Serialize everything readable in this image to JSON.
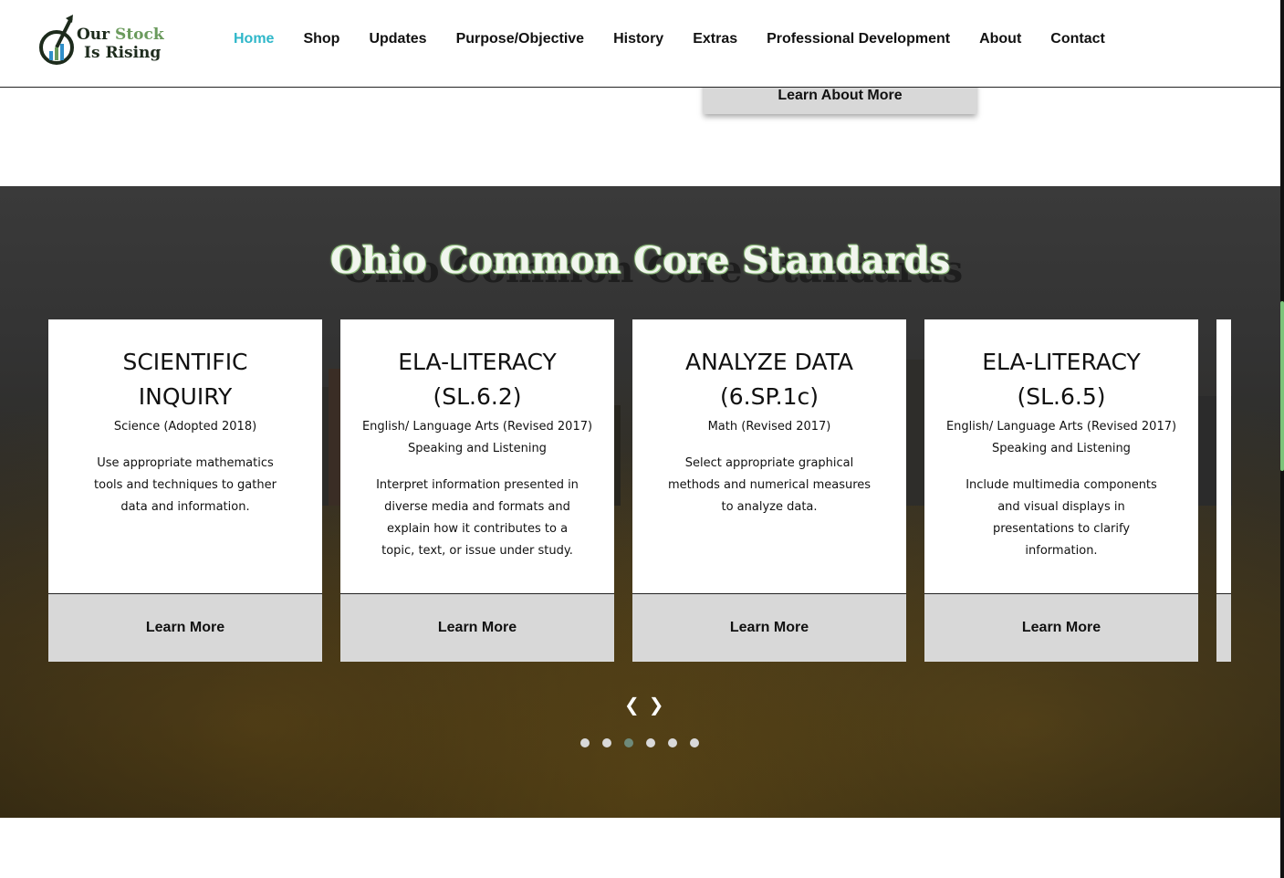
{
  "header": {
    "logo": {
      "line1_a": "Our ",
      "line1_b": "Stock",
      "line2": "Is Rising"
    },
    "nav": [
      {
        "label": "Home",
        "active": true
      },
      {
        "label": "Shop"
      },
      {
        "label": "Updates"
      },
      {
        "label": "Purpose/Objective"
      },
      {
        "label": "History"
      },
      {
        "label": "Extras"
      },
      {
        "label": "Professional Development"
      },
      {
        "label": "About"
      },
      {
        "label": "Contact"
      }
    ]
  },
  "about_button": "Learn About More",
  "section": {
    "title": "Ohio Common Core Standards",
    "cards": [
      {
        "title_1": "SCIENTIFIC",
        "title_2": "INQUIRY",
        "subject": "Science (Adopted 2018)",
        "strand": "",
        "description": "Use appropriate mathematics tools and techniques to gather data and information.",
        "button": "Learn More"
      },
      {
        "title_1": "ELA-LITERACY",
        "title_2": "(SL.6.2)",
        "subject": "English/ Language Arts (Revised 2017)",
        "strand": "Speaking and Listening",
        "description": "Interpret information presented in diverse media and formats and explain how it contributes to a topic, text, or issue under study.",
        "button": "Learn More"
      },
      {
        "title_1": "ANALYZE DATA",
        "title_2": "(6.SP.1c)",
        "subject": "Math (Revised 2017)",
        "strand": "",
        "description": "Select appropriate graphical methods and numerical measures to analyze data.",
        "button": "Learn More"
      },
      {
        "title_1": "ELA-LITERACY",
        "title_2": "(SL.6.5)",
        "subject": "English/ Language Arts (Revised 2017)",
        "strand": "Speaking and Listening",
        "description": "Include multimedia components and visual displays in presentations to clarify information.",
        "button": "Learn More"
      }
    ],
    "prev_arrow": "❮",
    "next_arrow": "❯",
    "dot_count": 6,
    "active_dot": 3
  },
  "colors": {
    "nav_active": "#2fb7c9",
    "logo_green": "#6a9a5c",
    "dot_active": "#6e8a7a"
  }
}
